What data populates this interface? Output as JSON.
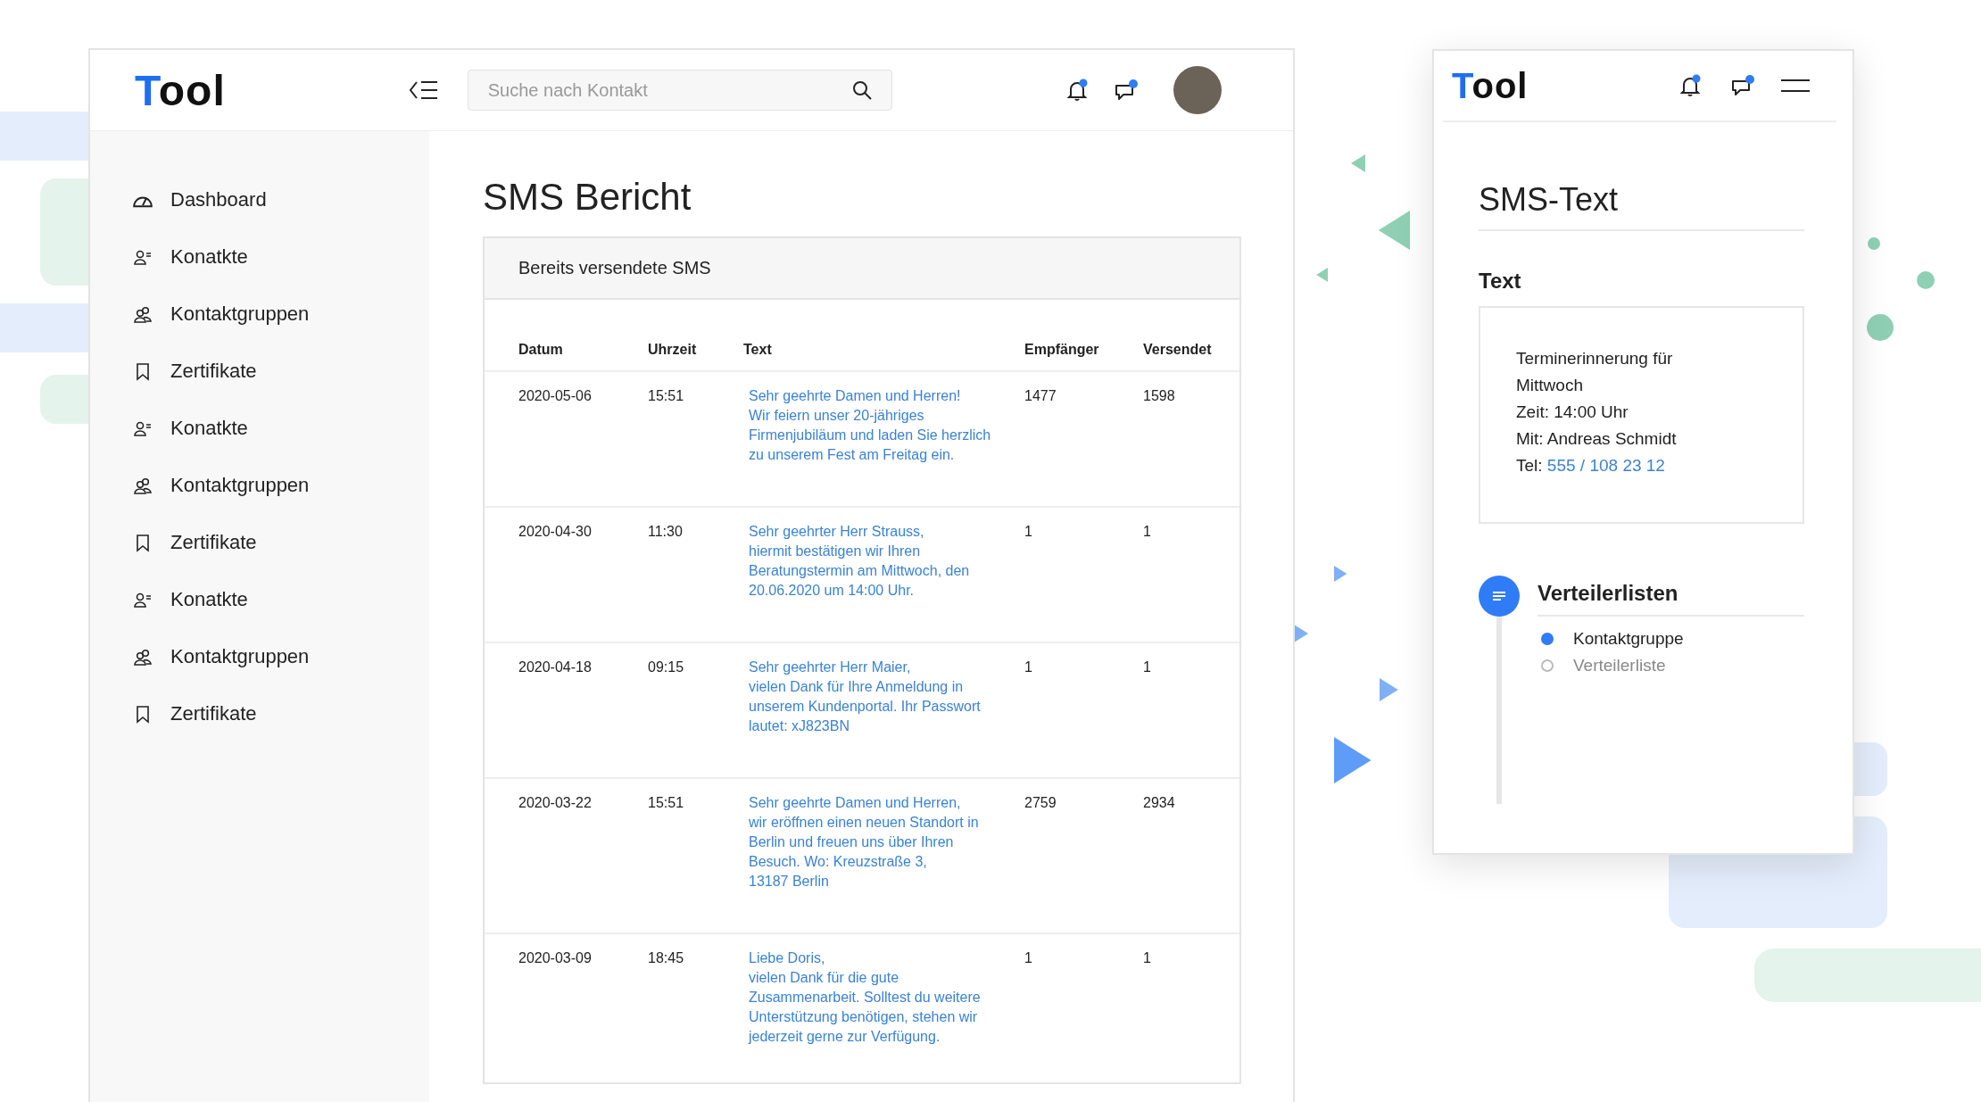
{
  "main_window": {
    "logo": {
      "accent": "T",
      "rest": "ool"
    },
    "search": {
      "placeholder": "Suche nach Kontakt"
    },
    "sidebar": {
      "items": [
        {
          "label": "Dashboard",
          "kind": "dashboard"
        },
        {
          "label": "Konatkte",
          "kind": "contact"
        },
        {
          "label": "Kontaktgruppen",
          "kind": "group"
        },
        {
          "label": "Zertifikate",
          "kind": "certificate"
        },
        {
          "label": "Konatkte",
          "kind": "contact"
        },
        {
          "label": "Kontaktgruppen",
          "kind": "group"
        },
        {
          "label": "Zertifikate",
          "kind": "certificate"
        },
        {
          "label": "Konatkte",
          "kind": "contact"
        },
        {
          "label": "Kontaktgruppen",
          "kind": "group"
        },
        {
          "label": "Zertifikate",
          "kind": "certificate"
        }
      ]
    },
    "page_title": "SMS Bericht",
    "card": {
      "title": "Bereits versendete SMS",
      "table": {
        "columns": [
          "Datum",
          "Uhrzeit",
          "Text",
          "Empfänger",
          "Versendet"
        ],
        "rows": [
          {
            "date": "2020-05-06",
            "time": "15:51",
            "text": [
              "Sehr geehrte Damen und Herren!",
              "Wir feiern unser 20-jähriges",
              "Firmenjubiläum und laden Sie herzlich",
              "zu unserem Fest am Freitag ein."
            ],
            "recipients": "1477",
            "sent": "1598"
          },
          {
            "date": "2020-04-30",
            "time": "11:30",
            "text": [
              "Sehr geehrter Herr Strauss,",
              "hiermit bestätigen wir Ihren",
              "Beratungstermin am Mittwoch, den",
              "20.06.2020 um 14:00 Uhr."
            ],
            "recipients": "1",
            "sent": "1"
          },
          {
            "date": "2020-04-18",
            "time": "09:15",
            "text": [
              "Sehr geehrter Herr Maier,",
              "vielen Dank für Ihre Anmeldung in",
              "unserem Kundenportal. Ihr Passwort",
              "lautet: xJ823BN"
            ],
            "recipients": "1",
            "sent": "1"
          },
          {
            "date": "2020-03-22",
            "time": "15:51",
            "text": [
              "Sehr geehrte Damen und Herren,",
              "wir eröffnen einen neuen Standort in",
              "Berlin und freuen uns über Ihren",
              "Besuch. Wo: Kreuzstraße 3,",
              "13187 Berlin"
            ],
            "recipients": "2759",
            "sent": "2934"
          },
          {
            "date": "2020-03-09",
            "time": "18:45",
            "text": [
              "Liebe Doris,",
              "vielen Dank für die gute",
              "Zusammenarbeit. Solltest du weitere",
              "Unterstützung benötigen, stehen wir",
              "jederzeit gerne zur Verfügung."
            ],
            "recipients": "1",
            "sent": "1"
          }
        ]
      }
    }
  },
  "mobile_panel": {
    "logo": {
      "accent": "T",
      "rest": "ool"
    },
    "title": "SMS-Text",
    "text_label": "Text",
    "message": {
      "lines": [
        "Terminerinnerung für",
        "Mittwoch",
        "Zeit: 14:00 Uhr",
        "Mit: Andreas Schmidt"
      ],
      "phone_label": "Tel:",
      "phone": "555 / 108 23 12"
    },
    "distribution": {
      "title": "Verteilerlisten",
      "options": [
        {
          "label": "Kontaktgruppe",
          "selected": true
        },
        {
          "label": "Verteilerliste",
          "selected": false
        }
      ]
    }
  }
}
